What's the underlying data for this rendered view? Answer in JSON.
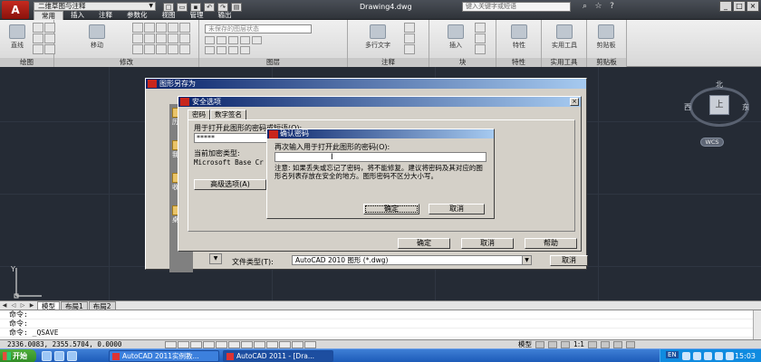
{
  "titlebar": {
    "app_logo": "A",
    "workspace": "二维草图与注释",
    "menu_tabs": [
      "常用",
      "插入",
      "注释",
      "参数化",
      "视图",
      "管理",
      "输出"
    ],
    "active_tab": "常用",
    "doc_title": "Drawing4.dwg",
    "search_placeholder": "键入关键字或短语",
    "win_buttons": [
      "_",
      "□",
      "×"
    ]
  },
  "ribbon": {
    "panels": [
      "绘图",
      "修改",
      "图层",
      "注释",
      "块",
      "特性",
      "实用工具",
      "剪贴板"
    ],
    "big_buttons": {
      "line": "直线",
      "move": "移动",
      "mtext": "多行文字",
      "insert": "插入",
      "properties": "特性",
      "utilities": "实用工具",
      "clipboard": "剪贴板"
    },
    "layer_state": "未保存的图层状态"
  },
  "viewcube": {
    "north": "北",
    "west": "西",
    "east": "东",
    "face": "上",
    "wcs": "WCS"
  },
  "layout_tabs": [
    "模型",
    "布局1",
    "布局2"
  ],
  "command_lines": [
    "命令:",
    "命令:",
    "命令: _QSAVE"
  ],
  "status": {
    "coords": "2336.0083, 2355.5704, 0.0000",
    "model": "模型",
    "scale": "1:1"
  },
  "taskbar": {
    "start": "开始",
    "items": [
      "AutoCAD 2011实例教...",
      "AutoCAD 2011 - [Dra..."
    ],
    "lang": "EN",
    "clock": "15:03"
  },
  "saveas_dialog": {
    "title": "图形另存为",
    "places": [
      "历史",
      "我的",
      "收藏",
      "桌面"
    ],
    "file_type_label": "文件类型(T):",
    "file_type_value": "AutoCAD 2010 图形 (*.dwg)",
    "cancel": "取消"
  },
  "security_dialog": {
    "title": "安全选项",
    "tabs": [
      "密码",
      "数字签名"
    ],
    "password_label": "用于打开此图形的密码或短语(O):",
    "password_value": "*****",
    "encryption_label": "当前加密类型:",
    "encryption_value": "Microsoft Base Cr",
    "advanced": "高级选项(A)",
    "ok": "确定",
    "cancel": "取消",
    "help": "帮助"
  },
  "confirm_dialog": {
    "title": "确认密码",
    "label": "再次输入用于打开此图形的密码(O):",
    "note": "注意: 如果丢失或忘记了密码，将不能修复。建议将密码及其对应的图形名列表存放在安全的地方。图形密码不区分大小写。",
    "ok": "确定",
    "cancel": "取消"
  }
}
